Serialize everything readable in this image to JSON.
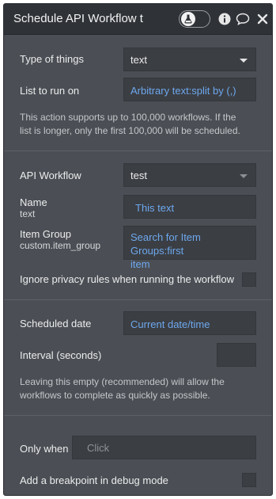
{
  "header": {
    "title": "Schedule API Workflow t",
    "icons": [
      "flask-icon",
      "info-icon",
      "comment-icon",
      "close-icon"
    ]
  },
  "section1": {
    "type_label": "Type of things",
    "type_value": "text",
    "list_label": "List to run on",
    "list_value": "Arbitrary text:split by (,)",
    "help_line1": "This action supports up to 100,000 workflows. If the",
    "help_line2": "list is longer, only the first 100,000 will be scheduled."
  },
  "section2": {
    "api_label": "API Workflow",
    "api_value": "test",
    "name_label": "Name",
    "name_type": "text",
    "name_value": "This text",
    "item_label": "Item Group",
    "item_type": "custom.item_group",
    "item_value_line1": "Search for Item Groups:first",
    "item_value_line2": "item",
    "privacy_label": "Ignore privacy rules when running the workflow",
    "privacy_checked": false
  },
  "section3": {
    "date_label": "Scheduled date",
    "date_value": "Current date/time",
    "interval_label": "Interval (seconds)",
    "interval_value": "",
    "help_line1": "Leaving this empty (recommended) will allow the",
    "help_line2": "workflows to complete as quickly as possible."
  },
  "section4": {
    "only_when_label": "Only when",
    "only_when_placeholder": "Click",
    "breakpoint_label": "Add a breakpoint in debug mode",
    "breakpoint_checked": false
  },
  "colors": {
    "panel_bg": "#4b4f55",
    "header_bg": "#2f3237",
    "field_bg": "#3b3e43",
    "dynamic_text": "#6ea8ee"
  }
}
